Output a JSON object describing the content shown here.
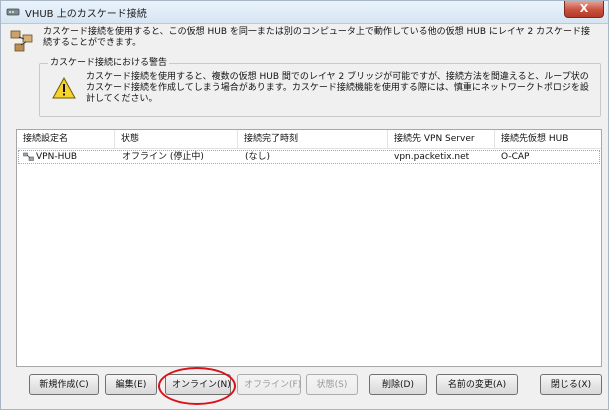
{
  "window": {
    "title": "VHUB 上のカスケード接続",
    "close_label": "X"
  },
  "intro": {
    "text": "カスケード接続を使用すると、この仮想 HUB を同一または別のコンピュータ上で動作している他の仮想 HUB にレイヤ 2 カスケード接続することができます。"
  },
  "warning": {
    "title": "カスケード接続における警告",
    "text": "カスケード接続を使用すると、複数の仮想 HUB 間でのレイヤ 2 ブリッジが可能ですが、接続方法を間違えると、ループ状のカスケード接続を作成してしまう場合があります。カスケード接続機能を使用する際には、慎重にネットワークトポロジを設計してください。"
  },
  "list": {
    "columns": [
      "接続設定名",
      "状態",
      "接続完了時刻",
      "接続先 VPN Server",
      "接続先仮想 HUB"
    ],
    "rows": [
      [
        "VPN-HUB",
        "オフライン (停止中)",
        "(なし)",
        "vpn.packetix.net",
        "O-CAP"
      ]
    ]
  },
  "buttons": {
    "new": "新規作成(C)",
    "edit": "編集(E)",
    "online": "オンライン(N)",
    "offline": "オフライン(F)",
    "status": "状態(S)",
    "delete": "削除(D)",
    "rename": "名前の変更(A)",
    "close": "閉じる(X)"
  },
  "colors": {
    "highlight": "#d9121a",
    "close_button": "#c8513f"
  }
}
